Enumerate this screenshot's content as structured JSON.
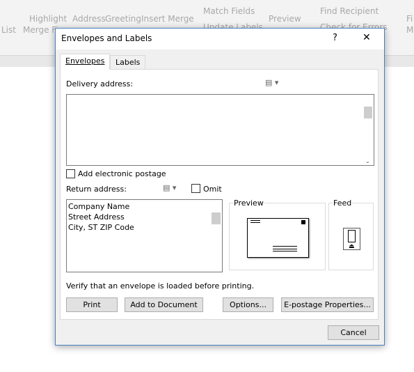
{
  "ribbon": {
    "items": [
      "List",
      "Highlight",
      "Merge Fi",
      "Address",
      "Greeting",
      "Insert Merge",
      "Match Fields",
      "Update Labels",
      "Preview",
      "Find Recipient",
      "Check for Errors",
      "Fi",
      "M"
    ]
  },
  "dialog": {
    "title": "Envelopes and Labels",
    "help": "?",
    "close": "✕",
    "tabs": [
      {
        "label": "Envelopes",
        "key": "E"
      },
      {
        "label": "Labels",
        "key": "L"
      }
    ],
    "delivery_label": "Delivery address:",
    "delivery_value": "",
    "electronic_postage": "Add electronic postage",
    "electronic_postage_checked": false,
    "return_label": "Return address:",
    "omit": "Omit",
    "omit_checked": false,
    "return_lines": [
      "Company Name",
      "Street Address",
      "City, ST ZIP Code"
    ],
    "preview": "Preview",
    "feed": "Feed",
    "verify": "Verify that an envelope is loaded before printing.",
    "buttons": {
      "print": "Print",
      "add": "Add to Document",
      "options": "Options...",
      "epostage": "E-postage Properties...",
      "cancel": "Cancel"
    }
  }
}
